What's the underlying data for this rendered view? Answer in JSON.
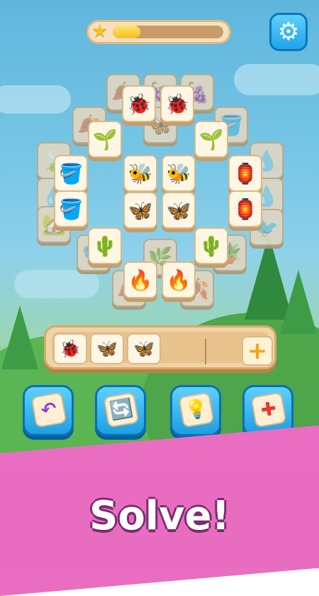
{
  "header": {
    "progress_percent": 25,
    "star_icon": "star-icon",
    "settings_icon": "gear-icon"
  },
  "colors": {
    "accent_blue": "#1da4e8",
    "tile_bg": "#fff6e4",
    "banner_pink": "#e86dc1",
    "progress_fill": "#f7be1d"
  },
  "board": {
    "top_tiles": [
      {
        "icon": "ladybug",
        "glyph": "🐞"
      },
      {
        "icon": "ladybug",
        "glyph": "🐞"
      },
      {
        "icon": "sprout",
        "glyph": "🌱"
      },
      {
        "icon": "sprout",
        "glyph": "🌱"
      },
      {
        "icon": "bucket",
        "glyph": "🪣"
      },
      {
        "icon": "bee",
        "glyph": "🐝"
      },
      {
        "icon": "bee",
        "glyph": "🐝"
      },
      {
        "icon": "birdcage",
        "glyph": "🏮"
      },
      {
        "icon": "bucket",
        "glyph": "🪣"
      },
      {
        "icon": "butterfly",
        "glyph": "🦋"
      },
      {
        "icon": "butterfly",
        "glyph": "🦋"
      },
      {
        "icon": "birdcage",
        "glyph": "🏮"
      },
      {
        "icon": "cactus",
        "glyph": "🌵"
      },
      {
        "icon": "cactus",
        "glyph": "🌵"
      },
      {
        "icon": "campfire",
        "glyph": "🔥"
      },
      {
        "icon": "campfire",
        "glyph": "🔥"
      }
    ]
  },
  "tray": {
    "slots": [
      {
        "icon": "ladybug",
        "glyph": "🐞"
      },
      {
        "icon": "butterfly",
        "glyph": "🦋"
      },
      {
        "icon": "butterfly",
        "glyph": "🦋"
      }
    ],
    "add_label": "+"
  },
  "boosters": [
    {
      "name": "undo",
      "glyph": "↶"
    },
    {
      "name": "shuffle",
      "glyph": "🔄"
    },
    {
      "name": "hint",
      "glyph": "💡"
    },
    {
      "name": "add-slot",
      "glyph": "✚"
    }
  ],
  "banner": {
    "title": "Solve!"
  }
}
